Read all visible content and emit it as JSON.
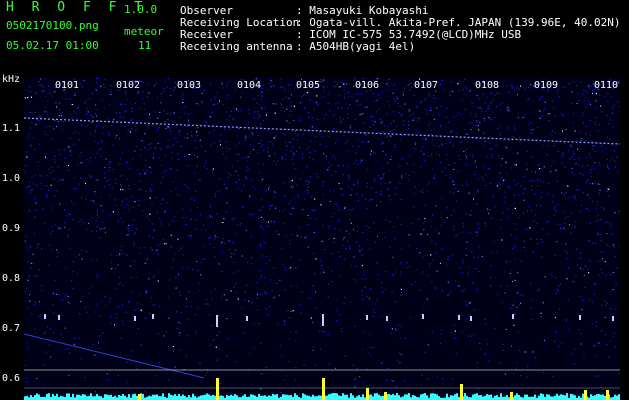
{
  "app": {
    "name": "H R O F F T",
    "version": "1.0.0"
  },
  "file": {
    "name": "0502170100.png",
    "datetime": "05.02.17 01:00"
  },
  "meteor": {
    "label": "meteor",
    "count": "11"
  },
  "info": [
    {
      "key": "Observer",
      "value": ": Masayuki Kobayashi"
    },
    {
      "key": "Receiving Location",
      "value": ": Ogata-vill. Akita-Pref. JAPAN (139.96E, 40.02N)"
    },
    {
      "key": "Receiver",
      "value": ": ICOM IC-575 53.7492(@LCD)MHz USB"
    },
    {
      "key": "Receiving antenna",
      "value": ": A504HB(yagi 4el)"
    }
  ],
  "axis": {
    "unit": "kHz",
    "y_ticks": [
      "1.1",
      "1.0",
      "0.9",
      "0.8",
      "0.7",
      "0.6"
    ],
    "x_ticks": [
      "0101",
      "0102",
      "0103",
      "0104",
      "0105",
      "0106",
      "0107",
      "0108",
      "0109",
      "0110"
    ]
  },
  "colors": {
    "background": "#000000",
    "text": "#ffffff",
    "header_accent": "#33ff33",
    "noise": "#1a2bff",
    "signal": "#ffffff",
    "meteor": "#ffff33",
    "cyan_baseline": "#33ffff"
  }
}
